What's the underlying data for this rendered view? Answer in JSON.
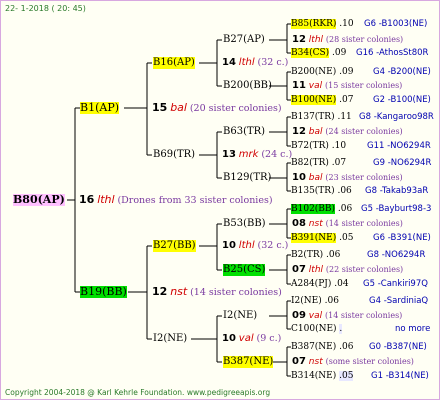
{
  "date": "22-  1-2018 ( 20: 45)",
  "footer": "Copyright 2004-2018 @ Karl Kehrle Foundation.   www.pedigreeapis.org",
  "root": {
    "label": "B80(AP)",
    "num": "16",
    "place": "lthl",
    "sisters": "(Drones from 33 sister colonies)"
  },
  "gen1": [
    {
      "label": "B1(AP)",
      "num": "15",
      "place": "bal",
      "sisters": "(20 sister colonies)"
    },
    {
      "label": "B19(BB)",
      "num": "12",
      "place": "nst",
      "sisters": "(14 sister colonies)"
    }
  ],
  "gen2": [
    {
      "label": "B16(AP)",
      "num": "14",
      "place": "lthl",
      "sisters": "(32 c.)"
    },
    {
      "label": "B69(TR)",
      "num": "13",
      "place": "mrk",
      "sisters": "(24 c.)"
    },
    {
      "label": "B27(BB)",
      "num": "10",
      "place": "lthl",
      "sisters": "(32 c.)"
    },
    {
      "label": "I2(NE)",
      "num": "10",
      "place": "val",
      "sisters": "(9 c.)"
    }
  ],
  "gen3": [
    {
      "label": "B27(AP)"
    },
    {
      "label": "B200(BB)"
    },
    {
      "label": "B63(TR)"
    },
    {
      "label": "B129(TR)"
    },
    {
      "label": "B53(BB)"
    },
    {
      "label": "B25(CS)"
    },
    {
      "label": "I2(NE)"
    },
    {
      "label": "B387(NE)"
    }
  ],
  "gen4": [
    {
      "top": {
        "label": "B85(RKR)",
        "val": ".10",
        "info": "G6 -B1003(NE)"
      },
      "num": "12",
      "place": "lthl",
      "sisters": "(28 sister colonies)",
      "bot": {
        "label": "B34(CS)",
        "val": ".09",
        "info": "G16 -AthosSt80R"
      }
    },
    {
      "top": {
        "label": "B200(NE)",
        "val": ".09",
        "info": "G4 -B200(NE)"
      },
      "num": "11",
      "place": "val",
      "sisters": "(15 sister colonies)",
      "bot": {
        "label": "B100(NE)",
        "val": ".07",
        "info": "G2 -B100(NE)"
      }
    },
    {
      "top": {
        "label": "B137(TR)",
        "val": ".11",
        "info": "G8 -Kangaroo98R"
      },
      "num": "12",
      "place": "bal",
      "sisters": "(24 sister colonies)",
      "bot": {
        "label": "B72(TR)",
        "val": ".10",
        "info": "G11 -NO6294R"
      }
    },
    {
      "top": {
        "label": "B82(TR)",
        "val": ".07",
        "info": "G9 -NO6294R"
      },
      "num": "10",
      "place": "bal",
      "sisters": "(23 sister colonies)",
      "bot": {
        "label": "B135(TR)",
        "val": ".06",
        "info": "G8 -Takab93aR"
      }
    },
    {
      "top": {
        "label": "B102(BB)",
        "val": ".06",
        "info": "G5 -Bayburt98-3"
      },
      "num": "08",
      "place": "nst",
      "sisters": "(14 sister colonies)",
      "bot": {
        "label": "B391(NE)",
        "val": ".05",
        "info": "G6 -B391(NE)"
      }
    },
    {
      "top": {
        "label": "B2(TR)",
        "val": ".06",
        "info": "G8 -NO6294R"
      },
      "num": "07",
      "place": "lthl",
      "sisters": "(22 sister colonies)",
      "bot": {
        "label": "A284(PJ)",
        "val": ".04",
        "info": "G5 -Cankiri97Q"
      }
    },
    {
      "top": {
        "label": "I2(NE)",
        "val": ".06",
        "info": "G4 -SardiniaQ"
      },
      "num": "09",
      "place": "val",
      "sisters": "(14 sister colonies)",
      "bot": {
        "label": "C100(NE)",
        "val": ".",
        "info": "no more"
      }
    },
    {
      "top": {
        "label": "B387(NE)",
        "val": ".06",
        "info": "G0 -B387(NE)"
      },
      "num": "07",
      "place": "nst",
      "sisters": "(some sister colonies)",
      "bot": {
        "label": "B314(NE)",
        "val": ".05",
        "info": "G1 -B314(NE)"
      }
    }
  ],
  "colors": {
    "highlight_yellow": "#ffff00",
    "highlight_green": "#00e000",
    "highlight_pink": "#ffc0ff",
    "place_red": "#d00000",
    "sister_purple": "#7a3aa0",
    "info_blue": "#0000b0",
    "border": "#d8a8e0"
  }
}
